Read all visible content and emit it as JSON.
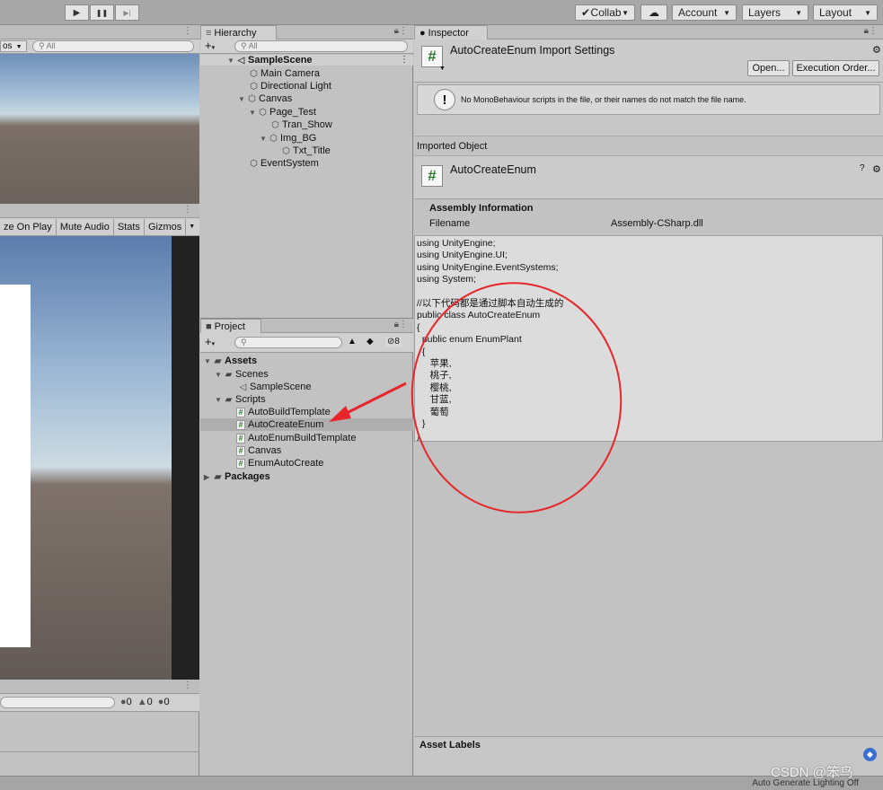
{
  "toolbar": {
    "play": "▶",
    "pause": "❚❚",
    "step": "▶|",
    "collab": "Collab",
    "account": "Account",
    "layers": "Layers",
    "layout": "Layout"
  },
  "scene": {
    "tab_dots": "⋮",
    "dropdown_partial": "os",
    "search_placeholder": "All"
  },
  "game": {
    "options": [
      "ze On Play",
      "Mute Audio",
      "Stats",
      "Gizmos"
    ]
  },
  "console": {
    "errors": "0",
    "warnings": "0",
    "infos": "0"
  },
  "hierarchy": {
    "title": "Hierarchy",
    "search_placeholder": "All",
    "scene_name": "SampleScene",
    "items": [
      {
        "label": "Main Camera"
      },
      {
        "label": "Directional Light"
      },
      {
        "label": "Canvas"
      },
      {
        "label": "Page_Test"
      },
      {
        "label": "Tran_Show"
      },
      {
        "label": "Img_BG"
      },
      {
        "label": "Txt_Title"
      },
      {
        "label": "EventSystem"
      }
    ]
  },
  "project": {
    "title": "Project",
    "hidden_count": "8",
    "assets": "Assets",
    "scenes_folder": "Scenes",
    "sample_scene": "SampleScene",
    "scripts_folder": "Scripts",
    "scripts": [
      "AutoBuildTemplate",
      "AutoCreateEnum",
      "AutoEnumBuildTemplate",
      "Canvas",
      "EnumAutoCreate"
    ],
    "packages": "Packages"
  },
  "inspector": {
    "title": "Inspector",
    "header_title": "AutoCreateEnum Import Settings",
    "open_button": "Open...",
    "execution_order_button": "Execution Order...",
    "warning": "No MonoBehaviour scripts in the file, or their names do not match the file name.",
    "imported_object_label": "Imported Object",
    "object_name": "AutoCreateEnum",
    "assembly_info_label": "Assembly Information",
    "filename_label": "Filename",
    "filename_value": "Assembly-CSharp.dll",
    "code": "using UnityEngine;\nusing UnityEngine.UI;\nusing UnityEngine.EventSystems;\nusing System;\n\n//以下代码都是通过脚本自动生成的\npublic class AutoCreateEnum\n{\n  public enum EnumPlant\n  {\n     苹果,\n     桃子,\n     樱桃,\n     甘蓝,\n     葡萄\n  }\n}",
    "asset_labels": "Asset Labels"
  },
  "statusbar": {
    "lighting": "Auto Generate Lighting Off"
  },
  "watermark": "CSDN @笨鸟",
  "colors": {
    "annotation_red": "#e8262a",
    "panel_bg": "#c2c2c2",
    "selected_row": "#aeaeae"
  }
}
